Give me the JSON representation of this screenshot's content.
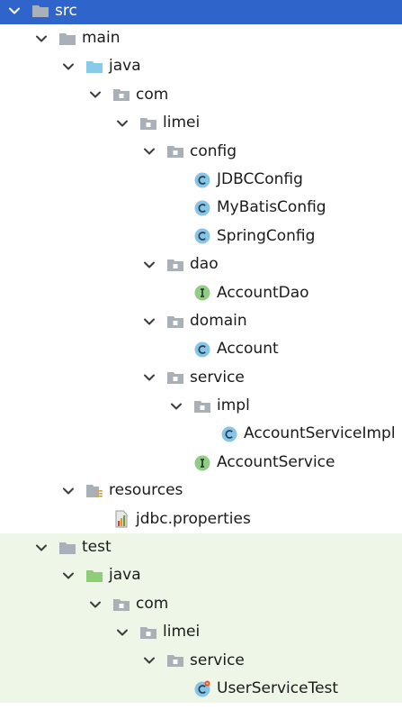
{
  "colors": {
    "selection": "#2f65ca",
    "test_background": "#eef6e8",
    "folder_gray": "#a9b0b8",
    "folder_source_blue": "#88cbe8",
    "folder_test_green": "#8ccf76",
    "class_icon": "#87c5e6",
    "interface_icon": "#91cb87"
  },
  "tree": [
    {
      "label": "src",
      "icon": "folder-gray",
      "expanded": true
    },
    {
      "label": "main",
      "icon": "folder-gray",
      "expanded": true
    },
    {
      "label": "java",
      "icon": "folder-source-blue",
      "expanded": true
    },
    {
      "label": "com",
      "icon": "package",
      "expanded": true
    },
    {
      "label": "limei",
      "icon": "package",
      "expanded": true
    },
    {
      "label": "config",
      "icon": "package",
      "expanded": true
    },
    {
      "label": "JDBCConfig",
      "icon": "class-c"
    },
    {
      "label": "MyBatisConfig",
      "icon": "class-c"
    },
    {
      "label": "SpringConfig",
      "icon": "class-c"
    },
    {
      "label": "dao",
      "icon": "package",
      "expanded": true
    },
    {
      "label": "AccountDao",
      "icon": "interface-i"
    },
    {
      "label": "domain",
      "icon": "package",
      "expanded": true
    },
    {
      "label": "Account",
      "icon": "class-c"
    },
    {
      "label": "service",
      "icon": "package",
      "expanded": true
    },
    {
      "label": "impl",
      "icon": "package",
      "expanded": true
    },
    {
      "label": "AccountServiceImpl",
      "icon": "class-c"
    },
    {
      "label": "AccountService",
      "icon": "interface-i"
    },
    {
      "label": "resources",
      "icon": "resources-folder",
      "expanded": true
    },
    {
      "label": "jdbc.properties",
      "icon": "properties-file"
    },
    {
      "label": "test",
      "icon": "folder-gray",
      "expanded": true
    },
    {
      "label": "java",
      "icon": "folder-test-green",
      "expanded": true
    },
    {
      "label": "com",
      "icon": "package",
      "expanded": true
    },
    {
      "label": "limei",
      "icon": "package",
      "expanded": true
    },
    {
      "label": "service",
      "icon": "package",
      "expanded": true
    },
    {
      "label": "UserServiceTest",
      "icon": "test-class"
    }
  ]
}
